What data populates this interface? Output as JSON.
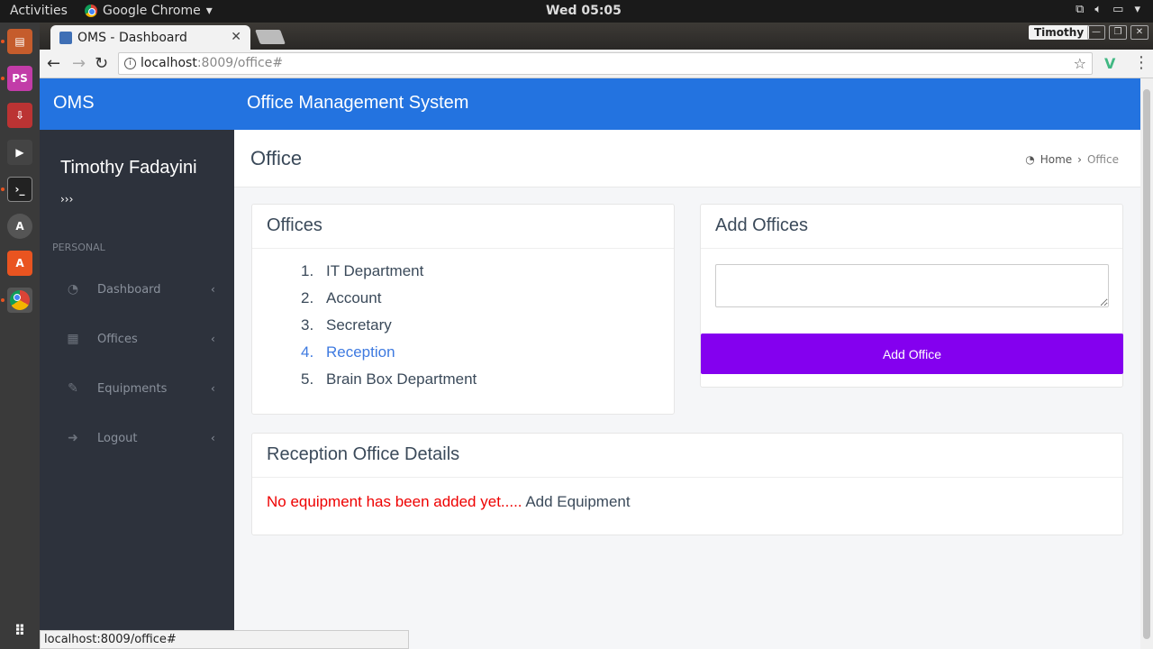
{
  "topbar": {
    "activities": "Activities",
    "app_name": "Google Chrome",
    "clock": "Wed 05:05"
  },
  "browser": {
    "tab_title": "OMS - Dashboard",
    "profile_name": "Timothy",
    "url_host": "localhost",
    "url_rest": ":8009/office#",
    "status_url": "localhost:8009/office#"
  },
  "app": {
    "brand": "OMS",
    "title": "Office Management System"
  },
  "sidebar": {
    "user_name": "Timothy Fadayini",
    "user_more": "›››",
    "section": "PERSONAL",
    "items": [
      {
        "label": "Dashboard",
        "icon": "dashboard-icon",
        "glyph": "◔"
      },
      {
        "label": "Offices",
        "icon": "building-icon",
        "glyph": "▦"
      },
      {
        "label": "Equipments",
        "icon": "wrench-icon",
        "glyph": "✎"
      },
      {
        "label": "Logout",
        "icon": "logout-icon",
        "glyph": "➜"
      }
    ]
  },
  "page": {
    "title": "Office",
    "breadcrumb": {
      "home": "Home",
      "current": "Office"
    }
  },
  "offices": {
    "title": "Offices",
    "items": [
      {
        "num": "1.",
        "name": "IT Department"
      },
      {
        "num": "2.",
        "name": "Account"
      },
      {
        "num": "3.",
        "name": "Secretary"
      },
      {
        "num": "4.",
        "name": "Reception"
      },
      {
        "num": "5.",
        "name": "Brain Box Department"
      }
    ],
    "active_index": 3
  },
  "add_office": {
    "title": "Add Offices",
    "input_value": "",
    "button_label": "Add Office"
  },
  "details": {
    "title": "Reception Office Details",
    "empty_message": "No equipment has been added yet.....",
    "add_link": "Add Equipment"
  },
  "colors": {
    "appbar": "#2373e0",
    "sidebar": "#2d323c",
    "add_button": "#8400ef",
    "warning": "#e00000",
    "active_link": "#3e7ae0"
  }
}
